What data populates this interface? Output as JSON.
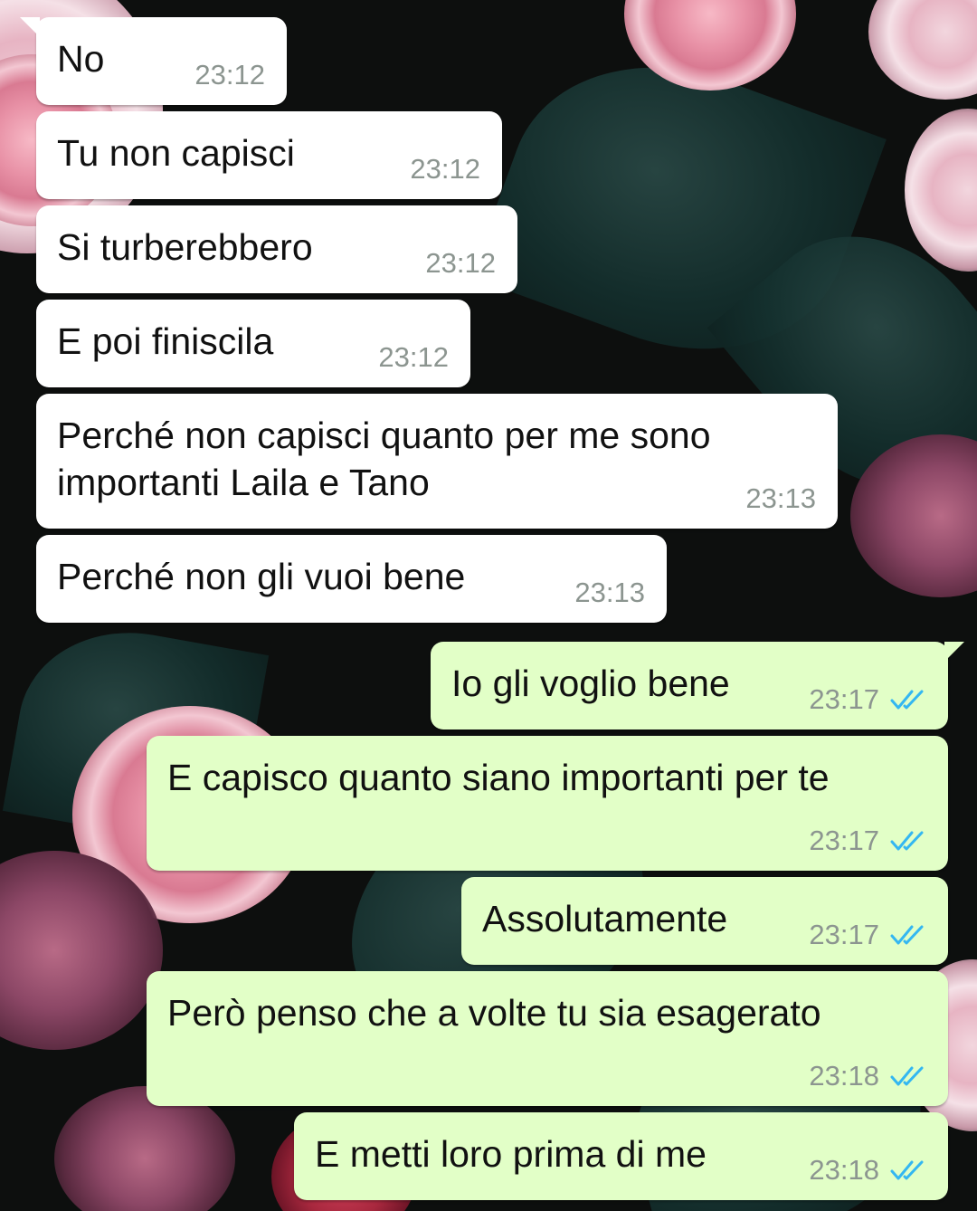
{
  "theme": {
    "incoming_bubble": "#ffffff",
    "outgoing_bubble": "#e2ffc7",
    "timestamp_color": "#8c9590",
    "read_tick_color": "#34b7f1"
  },
  "messages": [
    {
      "direction": "incoming",
      "text": "No",
      "time": "23:12"
    },
    {
      "direction": "incoming",
      "text": "Tu non capisci",
      "time": "23:12"
    },
    {
      "direction": "incoming",
      "text": "Si turberebbero",
      "time": "23:12"
    },
    {
      "direction": "incoming",
      "text": "E poi finiscila",
      "time": "23:12"
    },
    {
      "direction": "incoming",
      "text": "Perché non capisci quanto per me sono\nimportanti Laila e Tano",
      "time": "23:13"
    },
    {
      "direction": "incoming",
      "text": "Perché non gli vuoi bene",
      "time": "23:13"
    },
    {
      "direction": "outgoing",
      "text": "Io gli voglio bene",
      "time": "23:17",
      "status_icon": "double-check-read-icon"
    },
    {
      "direction": "outgoing",
      "text": "E capisco quanto siano importanti per te",
      "time": "23:17",
      "status_icon": "double-check-read-icon"
    },
    {
      "direction": "outgoing",
      "text": "Assolutamente",
      "time": "23:17",
      "status_icon": "double-check-read-icon"
    },
    {
      "direction": "outgoing",
      "text": "Però penso che a volte tu sia esagerato",
      "time": "23:18",
      "status_icon": "double-check-read-icon"
    },
    {
      "direction": "outgoing",
      "text": "E metti loro prima di me",
      "time": "23:18",
      "status_icon": "double-check-read-icon"
    }
  ]
}
